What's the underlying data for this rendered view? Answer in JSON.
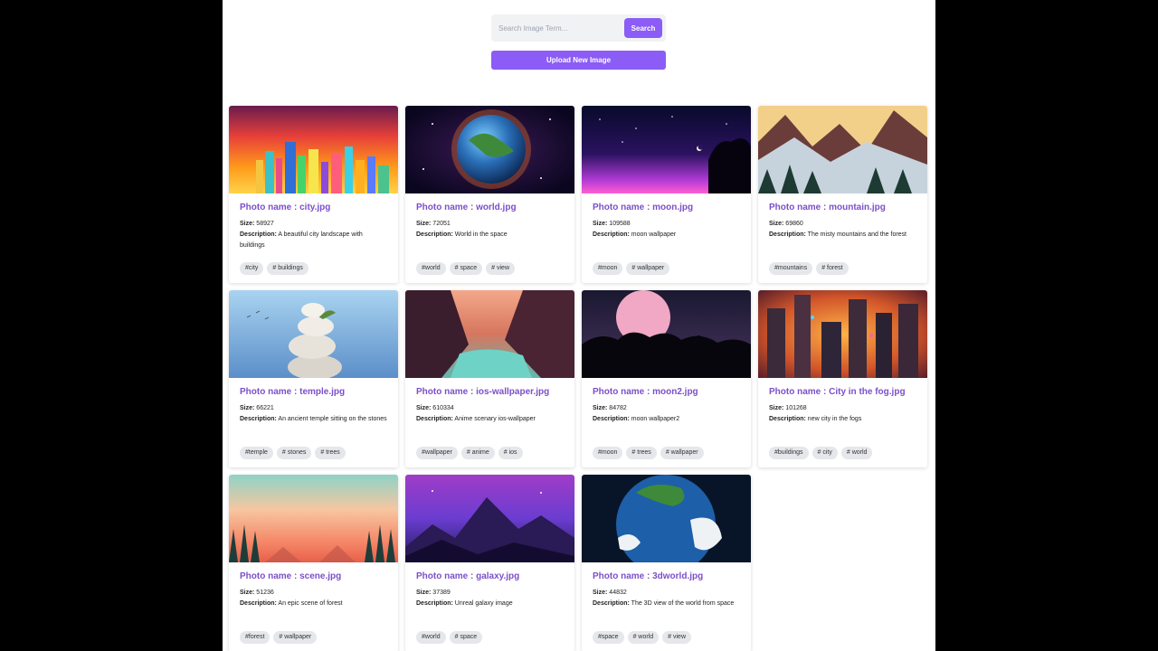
{
  "search": {
    "placeholder": "Search Image Term...",
    "button_label": "Search"
  },
  "upload_label": "Upload New Image",
  "labels": {
    "size": "Size:",
    "description": "Description:"
  },
  "images": [
    {
      "title": "Photo name : city.jpg",
      "size": "58927",
      "description": "A beautiful city landscape with buildings",
      "tags": [
        "#city",
        "# buildings"
      ]
    },
    {
      "title": "Photo name : world.jpg",
      "size": "72051",
      "description": "World in the space",
      "tags": [
        "#world",
        "# space",
        "# view"
      ]
    },
    {
      "title": "Photo name : moon.jpg",
      "size": "109588",
      "description": "moon wallpaper",
      "tags": [
        "#moon",
        "# wallpaper"
      ]
    },
    {
      "title": "Photo name : mountain.jpg",
      "size": "69860",
      "description": "The misty mountains and the forest",
      "tags": [
        "#mountains",
        "# forest"
      ]
    },
    {
      "title": "Photo name : temple.jpg",
      "size": "66221",
      "description": "An ancient temple sitting on the stones",
      "tags": [
        "#temple",
        "# stones",
        "# trees"
      ]
    },
    {
      "title": "Photo name : ios-wallpaper.jpg",
      "size": "610334",
      "description": "Anime scenary ios-wallpaper",
      "tags": [
        "#wallpaper",
        "# anime",
        "# ios"
      ]
    },
    {
      "title": "Photo name : moon2.jpg",
      "size": "84782",
      "description": "moon wallpaper2",
      "tags": [
        "#moon",
        "# trees",
        "# wallpaper"
      ]
    },
    {
      "title": "Photo name : City in the fog.jpg",
      "size": "101268",
      "description": "new city in the fogs",
      "tags": [
        "#buildings",
        "# city",
        "# world"
      ]
    },
    {
      "title": "Photo name : scene.jpg",
      "size": "51236",
      "description": "An epic scene of forest",
      "tags": [
        "#forest",
        "# wallpaper"
      ]
    },
    {
      "title": "Photo name : galaxy.jpg",
      "size": "37389",
      "description": "Unreal galaxy image",
      "tags": [
        "#world",
        "# space"
      ]
    },
    {
      "title": "Photo name : 3dworld.jpg",
      "size": "44832",
      "description": "The 3D view of the world from space",
      "tags": [
        "#space",
        "# world",
        "# view"
      ]
    }
  ]
}
